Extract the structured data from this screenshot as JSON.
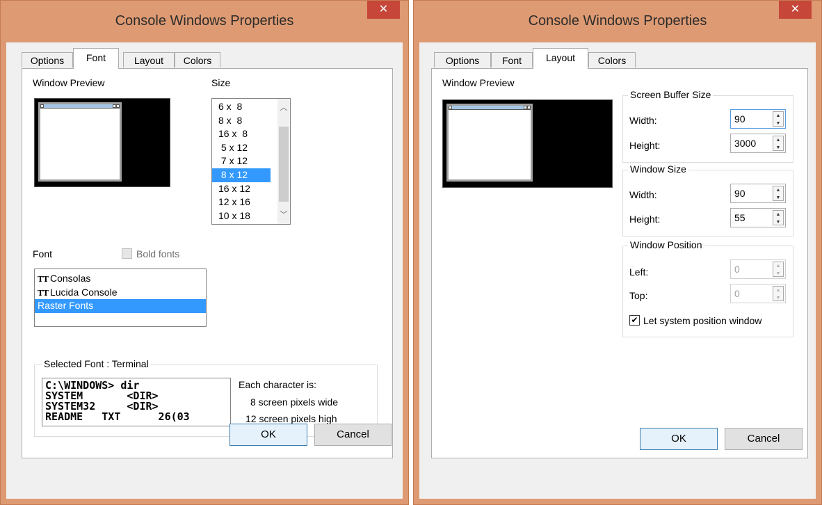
{
  "left_dialog": {
    "title": "Console Windows Properties",
    "close_label": "✕",
    "tabs": [
      "Options",
      "Font",
      "Layout",
      "Colors"
    ],
    "window_preview_label": "Window Preview",
    "size_label": "Size",
    "size_options": [
      "6 x  8",
      "8 x  8",
      "16 x  8",
      " 5 x 12",
      " 7 x 12",
      " 8 x 12",
      "16 x 12",
      "12 x 16",
      "10 x 18"
    ],
    "selected_size": "8 x 12",
    "font_label": "Font",
    "bold_fonts_label": "Bold fonts",
    "font_list": [
      "Consolas",
      "Lucida Console",
      "Raster Fonts"
    ],
    "selected_font": "Raster Fonts",
    "selected_font_group": "Selected Font : Terminal",
    "sample_lines": [
      "C:\\WINDOWS> dir",
      "SYSTEM       <DIR>",
      "SYSTEM32     <DIR>",
      "README   TXT      26(03"
    ],
    "char_info_title": "Each character is:",
    "char_width": "8 screen pixels wide",
    "char_height": "12 screen pixels high",
    "ok_label": "OK",
    "cancel_label": "Cancel"
  },
  "right_dialog": {
    "title": "Console Windows Properties",
    "close_label": "✕",
    "tabs": [
      "Options",
      "Font",
      "Layout",
      "Colors"
    ],
    "window_preview_label": "Window Preview",
    "screen_buffer": {
      "title": "Screen Buffer Size",
      "width_label": "Width:",
      "width_value": "90",
      "height_label": "Height:",
      "height_value": "3000"
    },
    "window_size": {
      "title": "Window Size",
      "width_label": "Width:",
      "width_value": "90",
      "height_label": "Height:",
      "height_value": "55"
    },
    "window_position": {
      "title": "Window Position",
      "left_label": "Left:",
      "left_value": "0",
      "top_label": "Top:",
      "top_value": "0",
      "let_system_label": "Let system position window",
      "let_system_checked": true
    },
    "ok_label": "OK",
    "cancel_label": "Cancel"
  },
  "colors": {
    "title_bar": "#de9a72",
    "close_button": "#c7463a",
    "selection": "#3399ff",
    "default_button_border": "#3c7fb1"
  }
}
